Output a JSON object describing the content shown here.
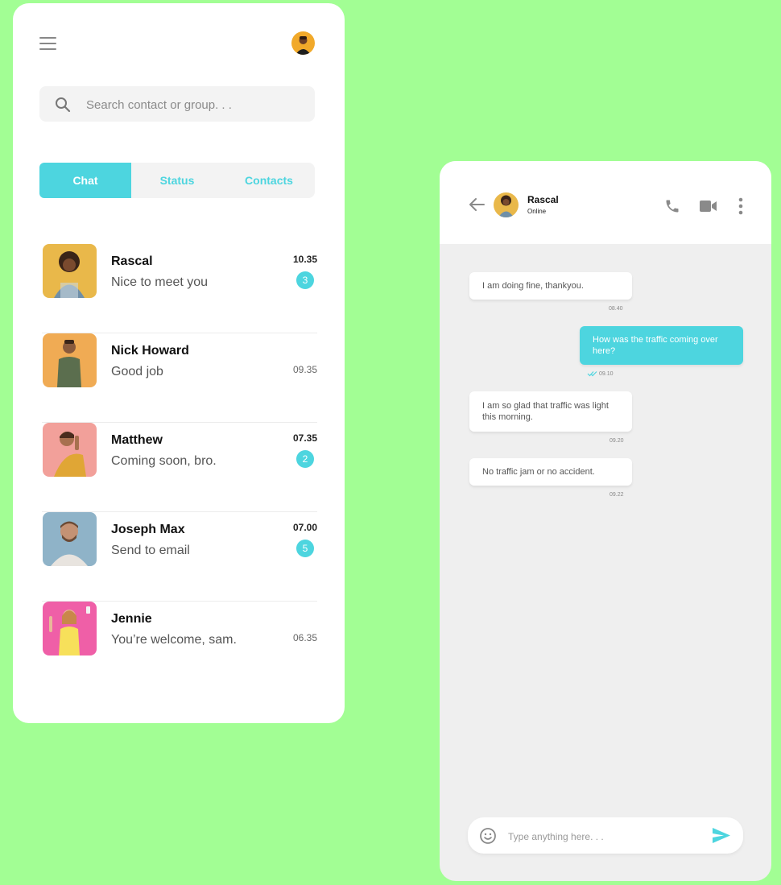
{
  "colors": {
    "background": "#a2fe94",
    "accent": "#4dd5df"
  },
  "left": {
    "search": {
      "placeholder": "Search contact or group. . ."
    },
    "tabs": [
      {
        "label": "Chat",
        "active": true
      },
      {
        "label": "Status",
        "active": false
      },
      {
        "label": "Contacts",
        "active": false
      }
    ],
    "chats": [
      {
        "name": "Rascal",
        "message": "Nice to meet you",
        "time": "10.35",
        "unread": "3",
        "avatar_bg": "#e9b84a"
      },
      {
        "name": "Nick Howard",
        "message": "Good job",
        "time": "09.35",
        "unread": "",
        "avatar_bg": "#f0ab54"
      },
      {
        "name": "Matthew",
        "message": "Coming soon, bro.",
        "time": "07.35",
        "unread": "2",
        "avatar_bg": "#f2a09a"
      },
      {
        "name": "Joseph Max",
        "message": "Send to email",
        "time": "07.00",
        "unread": "5",
        "avatar_bg": "#8fb3c8"
      },
      {
        "name": "Jennie",
        "message": "You’re welcome, sam.",
        "time": "06.35",
        "unread": "",
        "avatar_bg": "#ef5fa7"
      }
    ]
  },
  "right": {
    "contact": {
      "name": "Rascal",
      "status": "Online"
    },
    "messages": [
      {
        "text": "I am doing fine, thankyou.",
        "time": "08.40",
        "direction": "in"
      },
      {
        "text": "How was the traffic coming over here?",
        "time": "09.10",
        "direction": "out",
        "read": true
      },
      {
        "text": "I am so glad that traffic was light this morning.",
        "time": "09.20",
        "direction": "in"
      },
      {
        "text": "No traffic jam or no accident.",
        "time": "09.22",
        "direction": "in"
      }
    ],
    "composer": {
      "placeholder": "Type anything here. . ."
    }
  }
}
